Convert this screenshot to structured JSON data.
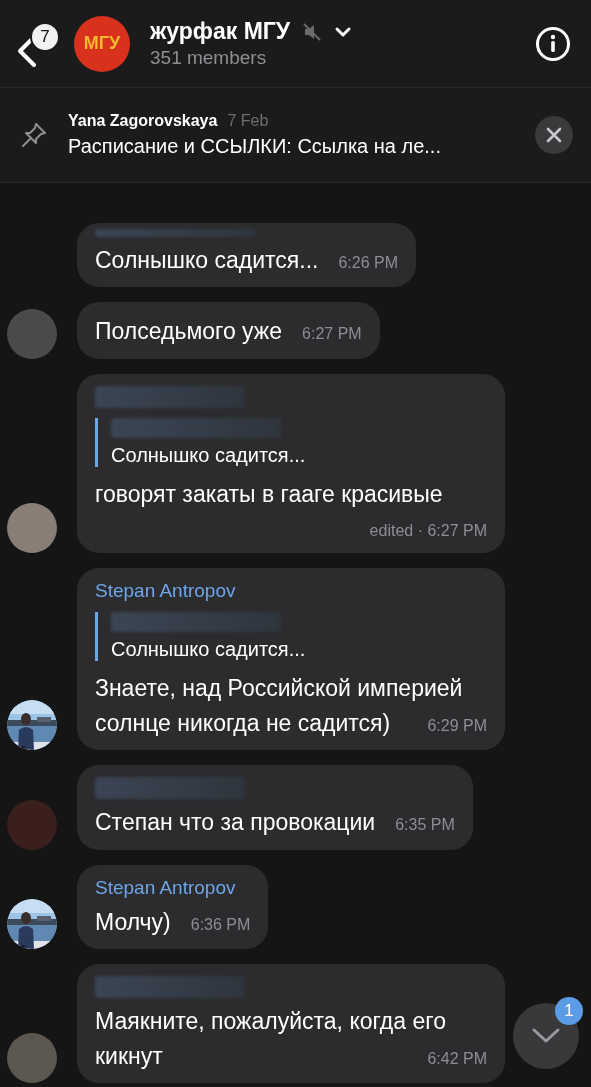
{
  "header": {
    "back_badge": "7",
    "avatar_text": "МГУ",
    "title": "журфак МГУ",
    "muted": true,
    "subtitle": "351 members"
  },
  "pinned": {
    "author": "Yana Zagorovskaya",
    "date": "7 Feb",
    "text": "Расписание и ССЫЛКИ: Ссылка на ле..."
  },
  "messages": [
    {
      "sender": {
        "kind": "cut"
      },
      "avatar": {
        "kind": "none"
      },
      "text": "Солнышко садится...",
      "time": "6:26 PM"
    },
    {
      "sender": {
        "kind": "none"
      },
      "avatar": {
        "kind": "blurred",
        "color": "#4a4a4c"
      },
      "text": "Полседьмого уже",
      "time": "6:27 PM"
    },
    {
      "sender": {
        "kind": "hidden"
      },
      "reply": {
        "sender": {
          "kind": "hidden"
        },
        "text": "Солнышко садится..."
      },
      "avatar": {
        "kind": "blurred",
        "color": "#8a7d76"
      },
      "text": "говорят закаты в гааге красивые",
      "time": "edited · 6:27 PM"
    },
    {
      "sender": {
        "kind": "name",
        "text": "Stepan Antropov"
      },
      "reply": {
        "sender": {
          "kind": "hidden"
        },
        "text": "Солнышко садится..."
      },
      "text": "Знаете, над Российской империей солнце никогда не садится)",
      "time": "6:29 PM"
    },
    {
      "sender": {
        "kind": "hidden"
      },
      "avatar": {
        "kind": "blurred",
        "color": "#3a1f1c"
      },
      "text": "Степан что за провокации",
      "time": "6:35 PM"
    },
    {
      "sender": {
        "kind": "name",
        "text": "Stepan Antropov"
      },
      "text": "Молчу)",
      "time": "6:36 PM"
    },
    {
      "sender": {
        "kind": "hidden"
      },
      "avatar": {
        "kind": "blurred",
        "color": "#5c5751"
      },
      "text": "Маякните, пожалуйста, когда его кикнут",
      "time": "6:42 PM"
    }
  ],
  "scroll_button": {
    "badge": "1"
  }
}
